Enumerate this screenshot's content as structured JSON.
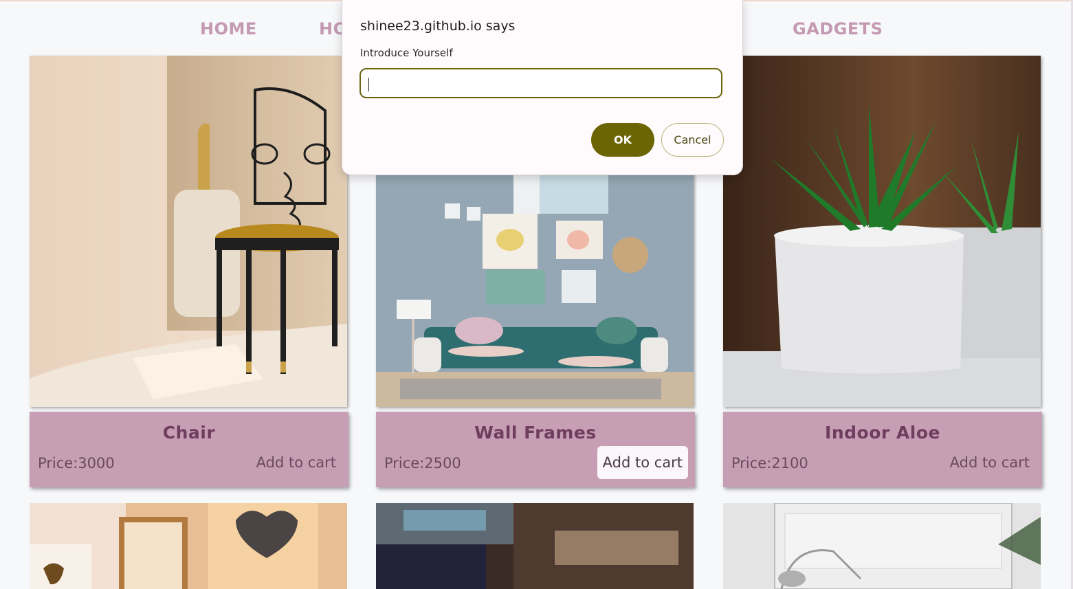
{
  "nav": {
    "items": [
      {
        "label": "HOME"
      },
      {
        "label": "HO"
      },
      {
        "label": "GADGETS"
      }
    ]
  },
  "products": [
    {
      "name": "Chair",
      "price": "Price:3000",
      "cart_label": "Add to cart",
      "image": "chair-photo"
    },
    {
      "name": "Wall Frames",
      "price": "Price:2500",
      "cart_label": "Add to cart",
      "image": "living-room-wall-frames-photo"
    },
    {
      "name": "Indoor Aloe",
      "price": "Price:2100",
      "cart_label": "Add to cart",
      "image": "potted-aloe-photo"
    }
  ],
  "dialog": {
    "title": "shinee23.github.io says",
    "message": "Introduce Yourself",
    "input_value": "",
    "ok_label": "OK",
    "cancel_label": "Cancel"
  },
  "colors": {
    "nav_text": "#c49ab3",
    "card_info_bg": "#c69fb5",
    "card_title": "#6f3d5d",
    "ok_button": "#6b6504"
  }
}
